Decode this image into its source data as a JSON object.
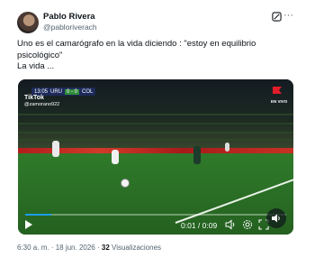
{
  "author": {
    "name": "Pablo Rivera",
    "handle": "@pabloriverach"
  },
  "tweet": {
    "lines": [
      "Uno es el camarógrafo en la vida diciendo : \"estoy en equilibrio",
      "psicológico\"",
      "La vida ..."
    ]
  },
  "video": {
    "scorebug": {
      "clock": "13:05",
      "home": "URU",
      "score": "0 - 0",
      "away": "COL"
    },
    "watermark_brand": "TikTok",
    "watermark_user": "@zamorano922",
    "broadcast_label": "EN VIVO",
    "time": "0:01 / 0:09",
    "progress": 0.1
  },
  "meta": {
    "time": "6:30 a. m.",
    "date": "18 jun. 2026",
    "views_count": "32",
    "views_label": "Visualizaciones"
  },
  "colors": {
    "accent": "#1d9bf0",
    "text": "#0f1419",
    "muted": "#536471"
  }
}
